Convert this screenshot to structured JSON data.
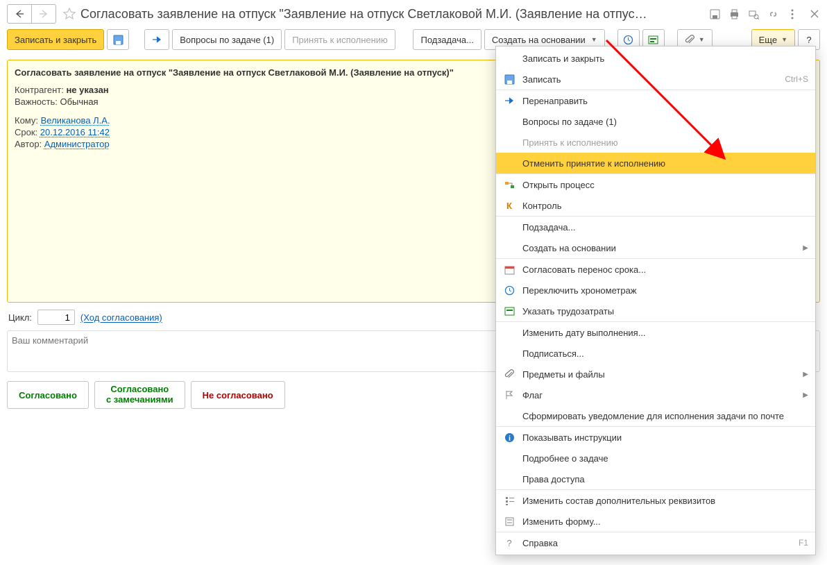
{
  "header": {
    "title": "Согласовать заявление на отпуск \"Заявление на отпуск Светлаковой М.И. (Заявление на отпус…"
  },
  "toolbar": {
    "save_close": "Записать и закрыть",
    "questions": "Вопросы по задаче (1)",
    "accept": "Принять к исполнению",
    "subtask": "Подзадача...",
    "create_based": "Создать на основании",
    "more": "Еще",
    "help": "?"
  },
  "info": {
    "title": "Согласовать заявление на отпуск \"Заявление на отпуск Светлаковой М.И. (Заявление на отпуск)\"",
    "counterparty_lbl": "Контрагент: ",
    "counterparty_val": "не указан",
    "importance_lbl": "Важность: ",
    "importance_val": "Обычная",
    "to_lbl": "Кому: ",
    "to_val": "Великанова Л.А.",
    "deadline_lbl": "Срок: ",
    "deadline_val": "20.12.2016 11:42",
    "author_lbl": "Автор: ",
    "author_val": "Администратор"
  },
  "cycle": {
    "label": "Цикл:",
    "value": "1",
    "progress_link": "(Ход согласования)"
  },
  "comment": {
    "placeholder": "Ваш комментарий"
  },
  "actions": {
    "agreed": "Согласовано",
    "agreed_notes": "Согласовано\nс замечаниями",
    "not_agreed": "Не согласовано"
  },
  "menu": {
    "items": [
      {
        "label": "Записать и закрыть",
        "icon": "",
        "shortcut": "",
        "disabled": false,
        "sep": false,
        "submenu": false
      },
      {
        "label": "Записать",
        "icon": "disk",
        "shortcut": "Ctrl+S",
        "disabled": false,
        "sep": false,
        "submenu": false
      },
      {
        "label": "Перенаправить",
        "icon": "arrow-right",
        "shortcut": "",
        "disabled": false,
        "sep": true,
        "submenu": false
      },
      {
        "label": "Вопросы по задаче (1)",
        "icon": "",
        "shortcut": "",
        "disabled": false,
        "sep": false,
        "submenu": false
      },
      {
        "label": "Принять к исполнению",
        "icon": "",
        "shortcut": "",
        "disabled": true,
        "sep": false,
        "submenu": false
      },
      {
        "label": "Отменить принятие к исполнению",
        "icon": "",
        "shortcut": "",
        "disabled": false,
        "sep": false,
        "submenu": false,
        "hover": true
      },
      {
        "label": "Открыть процесс",
        "icon": "process",
        "shortcut": "",
        "disabled": false,
        "sep": true,
        "submenu": false
      },
      {
        "label": "Контроль",
        "icon": "k",
        "shortcut": "",
        "disabled": false,
        "sep": false,
        "submenu": false
      },
      {
        "label": "Подзадача...",
        "icon": "",
        "shortcut": "",
        "disabled": false,
        "sep": true,
        "submenu": false
      },
      {
        "label": "Создать на основании",
        "icon": "",
        "shortcut": "",
        "disabled": false,
        "sep": false,
        "submenu": true
      },
      {
        "label": "Согласовать перенос срока...",
        "icon": "calendar",
        "shortcut": "",
        "disabled": false,
        "sep": true,
        "submenu": false
      },
      {
        "label": "Переключить хронометраж",
        "icon": "clock",
        "shortcut": "",
        "disabled": false,
        "sep": false,
        "submenu": false
      },
      {
        "label": "Указать трудозатраты",
        "icon": "tz",
        "shortcut": "",
        "disabled": false,
        "sep": false,
        "submenu": false
      },
      {
        "label": "Изменить дату выполнения...",
        "icon": "",
        "shortcut": "",
        "disabled": false,
        "sep": true,
        "submenu": false
      },
      {
        "label": "Подписаться...",
        "icon": "",
        "shortcut": "",
        "disabled": false,
        "sep": false,
        "submenu": false
      },
      {
        "label": "Предметы и файлы",
        "icon": "clip",
        "shortcut": "",
        "disabled": false,
        "sep": false,
        "submenu": true
      },
      {
        "label": "Флаг",
        "icon": "flag",
        "shortcut": "",
        "disabled": false,
        "sep": false,
        "submenu": true
      },
      {
        "label": "Сформировать уведомление для исполнения задачи по почте",
        "icon": "",
        "shortcut": "",
        "disabled": false,
        "sep": false,
        "submenu": false
      },
      {
        "label": "Показывать инструкции",
        "icon": "info",
        "shortcut": "",
        "disabled": false,
        "sep": true,
        "submenu": false
      },
      {
        "label": "Подробнее о задаче",
        "icon": "",
        "shortcut": "",
        "disabled": false,
        "sep": false,
        "submenu": false
      },
      {
        "label": "Права доступа",
        "icon": "",
        "shortcut": "",
        "disabled": false,
        "sep": false,
        "submenu": false
      },
      {
        "label": "Изменить состав дополнительных реквизитов",
        "icon": "list",
        "shortcut": "",
        "disabled": false,
        "sep": true,
        "submenu": false
      },
      {
        "label": "Изменить форму...",
        "icon": "form",
        "shortcut": "",
        "disabled": false,
        "sep": false,
        "submenu": false
      },
      {
        "label": "Справка",
        "icon": "q",
        "shortcut": "F1",
        "disabled": false,
        "sep": true,
        "submenu": false
      }
    ]
  }
}
